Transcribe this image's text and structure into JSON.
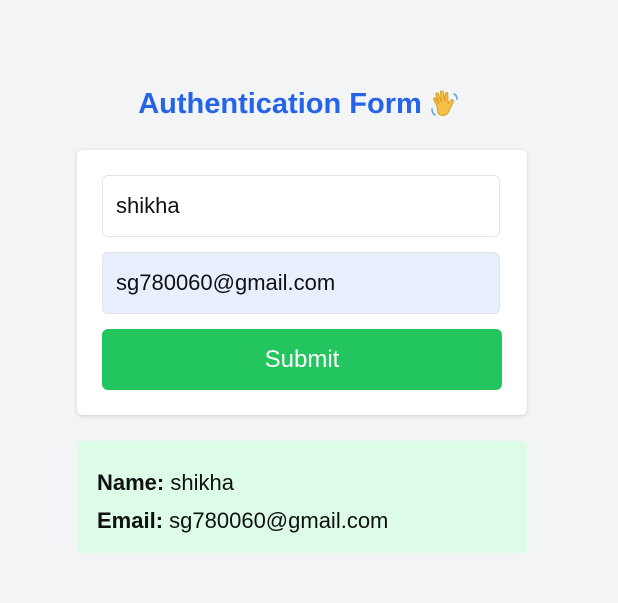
{
  "header": {
    "title": "Authentication Form",
    "icon": "waving-hand-icon"
  },
  "form": {
    "name_value": "shikha",
    "email_value": "sg780060@gmail.com",
    "submit_label": "Submit"
  },
  "result": {
    "name_label": "Name:",
    "name_value": "shikha",
    "email_label": "Email:",
    "email_value": "sg780060@gmail.com"
  },
  "colors": {
    "page_background": "#f3f4f6",
    "title": "#2563eb",
    "submit_button": "#22c55e",
    "autofill_field": "#e8f0fe",
    "result_background": "#dcfce7"
  }
}
